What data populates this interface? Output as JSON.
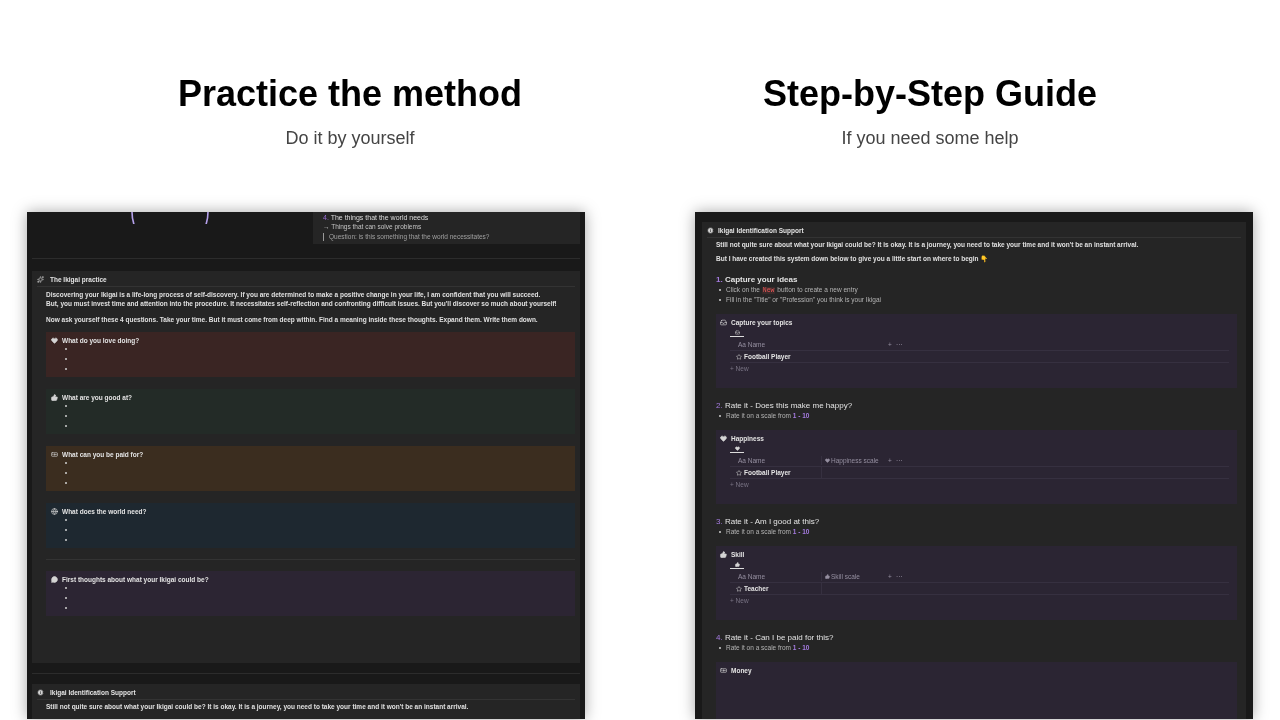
{
  "columns": [
    {
      "title": "Practice the method",
      "subtitle": "Do it by yourself"
    },
    {
      "title": "Step-by-Step Guide",
      "subtitle": "If you need some help"
    }
  ],
  "practice_screenshot": {
    "world_card": {
      "number": "4.",
      "heading": "The things that the world needs",
      "note": "→ Things that can solve problems",
      "quote": "Question: is this something that the world necessitates?"
    },
    "practice_callout": {
      "title": "The Ikigai practice",
      "paragraphs": [
        "Discovering your Ikigai is a life-long process of self-discovery. If you are determined to make a positive change in your life, I am confident that you will succeed.",
        "But, you must invest time and attention into the procedure. It necessitates self-reflection and confronting difficult issues. But you'll discover so much about yourself!"
      ],
      "prompt": "Now ask yourself these 4 questions. Take your time. But it must come from deep within. Find a meaning inside these thoughts. Expand them. Write them down.",
      "questions": [
        {
          "title": "What do you love doing?",
          "color": "#3a2523"
        },
        {
          "title": "What are you good at?",
          "color": "#232b27"
        },
        {
          "title": "What can you be paid for?",
          "color": "#3b2d1f"
        },
        {
          "title": "What does the world need?",
          "color": "#1e2830"
        }
      ],
      "thoughts": {
        "title": "First thoughts about what your Ikigai could be?",
        "color": "#2c2533"
      }
    },
    "support_callout": {
      "title": "Ikigai Identification Support",
      "text": "Still not quite sure about what your Ikigai could be? It is okay.  It is a journey, you need to take your time and it won't be an instant arrival."
    }
  },
  "guide_screenshot": {
    "title": "Ikigai Identification Support",
    "paragraphs": [
      "Still not quite sure about what your Ikigai could be? It is okay.  It is a journey, you need to take your time and it won't be an instant arrival.",
      "But I have created this system down below to give you a little start on where to begin 👇"
    ],
    "steps": [
      {
        "number": "1.",
        "title": "Capture your ideas",
        "bullets": [
          {
            "kind": "code",
            "before": "Click on the",
            "code": "New",
            "after": "button to create a new entry"
          },
          {
            "kind": "plain",
            "text": "Fill in the \"Title\" or \"Profession\" you think is your Ikigai"
          }
        ],
        "database": {
          "title": "Capture your topics",
          "name_column": "Aa Name",
          "row": "Football Player",
          "add": "+",
          "more": "···",
          "new": "+ New"
        }
      },
      {
        "number": "2.",
        "title": "Rate it  - Does this make me happy?",
        "bullets": [
          {
            "kind": "range",
            "text": "Rate it on a scale from",
            "range": "1 - 10"
          }
        ],
        "database": {
          "title": "Happiness",
          "name_column": "Aa Name",
          "scale_column": "Happiness scale",
          "row": "Football Player",
          "add": "+",
          "more": "···",
          "new": "+ New"
        }
      },
      {
        "number": "3.",
        "title": "Rate it  - Am I good at this?",
        "bullets": [
          {
            "kind": "range",
            "text": "Rate it on a scale from",
            "range": "1 - 10"
          }
        ],
        "database": {
          "title": "Skill",
          "name_column": "Aa Name",
          "scale_column": "Skill scale",
          "row": "Teacher",
          "add": "+",
          "more": "···",
          "new": "+ New"
        }
      },
      {
        "number": "4.",
        "title": "Rate it  - Can I be paid for this?",
        "bullets": [
          {
            "kind": "range",
            "text": "Rate it on a scale from",
            "range": "1 - 10"
          }
        ],
        "database": {
          "title": "Money"
        }
      }
    ]
  }
}
